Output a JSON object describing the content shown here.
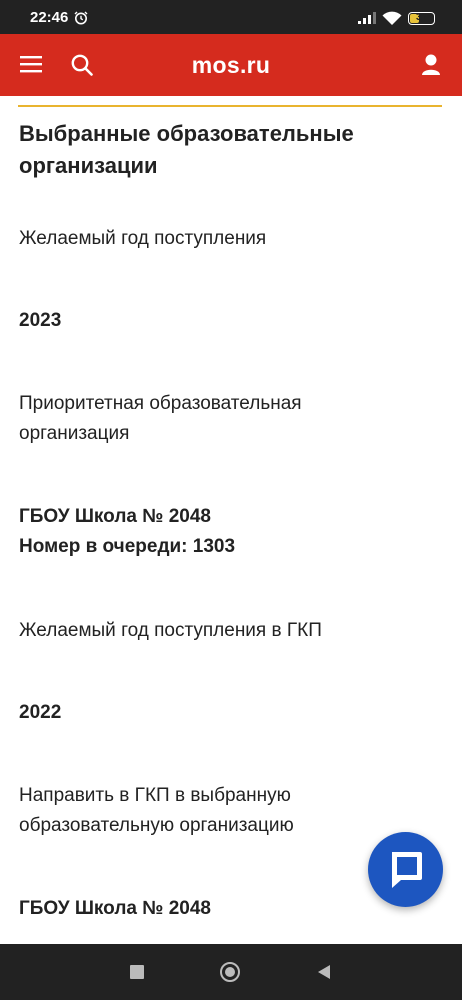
{
  "status_bar": {
    "time": "22:46",
    "battery": "32",
    "icons": [
      "alarm-icon",
      "signal-icon",
      "wifi-icon",
      "battery-icon"
    ]
  },
  "header": {
    "title": "mos.ru",
    "icons": [
      "menu-icon",
      "search-icon",
      "user-icon"
    ]
  },
  "colors": {
    "header_bg": "#d52b1e",
    "divider": "#e9b42f",
    "chat_button": "#1d56c0"
  },
  "content": {
    "section_title": "Выбранные образовательные организации",
    "desired_year_label": "Желаемый год поступления",
    "desired_year_value": "2023",
    "priority_org_label": "Приоритетная образовательная организация",
    "priority_org_name": "ГБОУ Школа № 2048",
    "queue_number": "Номер в очереди: 1303",
    "gkp_year_label": "Желаемый год поступления в ГКП",
    "gkp_year_value": "2022",
    "gkp_direction_label": "Направить в ГКП в выбранную образовательную организацию",
    "gkp_org_name": "ГБОУ Школа № 2048"
  },
  "chat": {
    "icon": "chat-icon"
  },
  "nav": {
    "icons": [
      "recent-apps-icon",
      "home-icon",
      "back-icon"
    ]
  }
}
